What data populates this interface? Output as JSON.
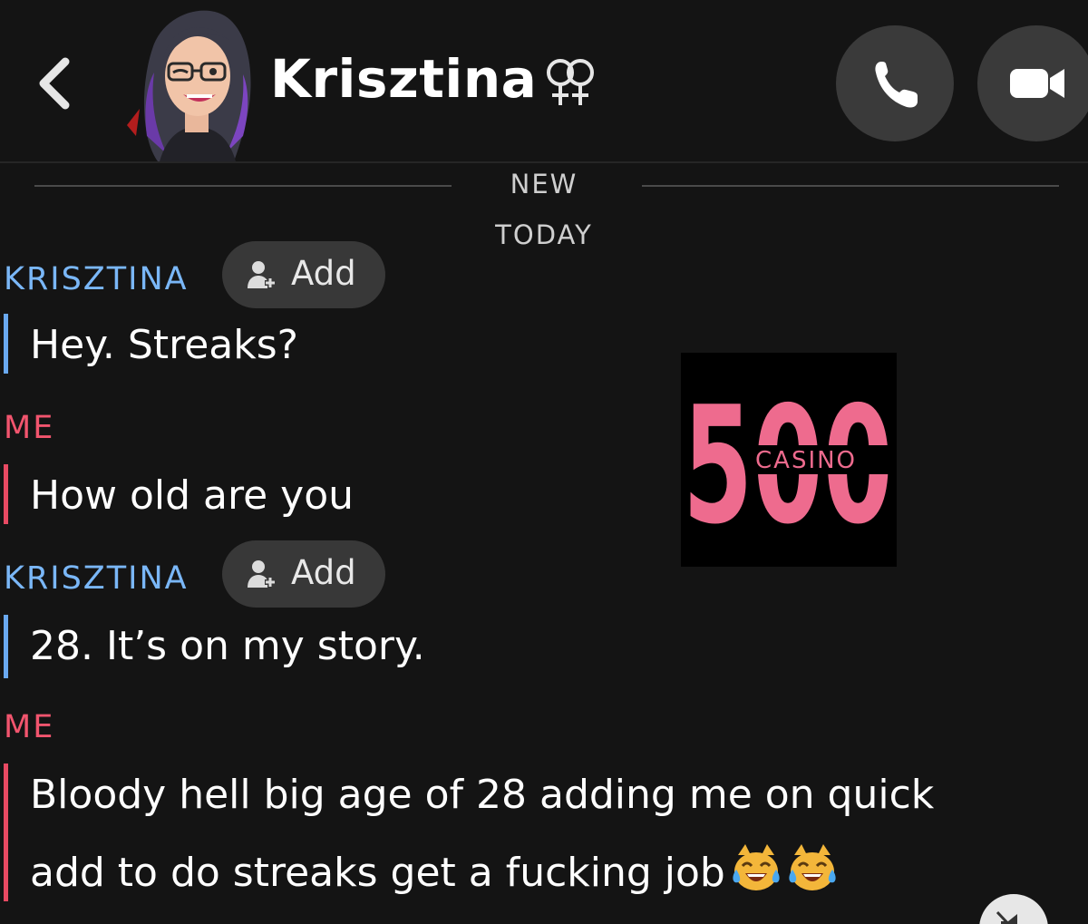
{
  "header": {
    "contact_name": "Krisztina",
    "back_icon": "chevron-left-icon",
    "gender_icon": "double-female-symbol-icon",
    "call_icon": "phone-icon",
    "video_icon": "video-camera-icon",
    "button_color": "#3a3a3a"
  },
  "separator": {
    "new_label": "NEW",
    "today_label": "TODAY"
  },
  "messages": [
    {
      "sender": "KRISZTINA",
      "from": "them",
      "add_label": "Add",
      "text": "Hey. Streaks?"
    },
    {
      "sender": "ME",
      "from": "me",
      "text": "How old are you"
    },
    {
      "sender": "KRISZTINA",
      "from": "them",
      "add_label": "Add",
      "text": "28. It’s on my story."
    },
    {
      "sender": "ME",
      "from": "me",
      "lines": [
        "Bloody hell big age of 28 adding me on quick",
        "add to do streaks get a fucking job"
      ],
      "emoji": [
        "laughing-cat-tears-icon",
        "laughing-cat-tears-icon"
      ]
    }
  ],
  "overlay_logo": {
    "number": "500",
    "word": "CASINO",
    "color": "#ee6b8e"
  },
  "colors": {
    "them": "#7ab7f7",
    "me": "#f2556e",
    "background": "#141414"
  },
  "mute_icon": "speaker-muted-icon"
}
